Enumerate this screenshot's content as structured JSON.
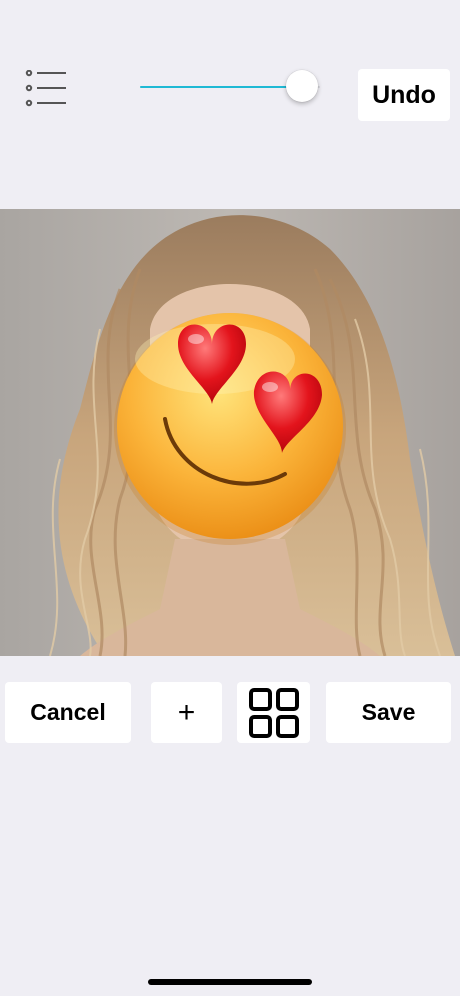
{
  "toolbar": {
    "menu_icon": "list-icon",
    "undo_label": "Undo",
    "slider": {
      "value": 0.9,
      "track_color": "#D6D6DC",
      "fill_color": "#1FB9D4"
    }
  },
  "photo": {
    "subject": "photo-with-emoji-overlay",
    "overlay_emoji": "smiling-face-with-heart-eyes-icon"
  },
  "actions": {
    "cancel_label": "Cancel",
    "add_label": "+",
    "grid_icon": "grid-icon",
    "save_label": "Save"
  },
  "colors": {
    "background": "#EFEEF4",
    "accent": "#1FB9D4"
  }
}
